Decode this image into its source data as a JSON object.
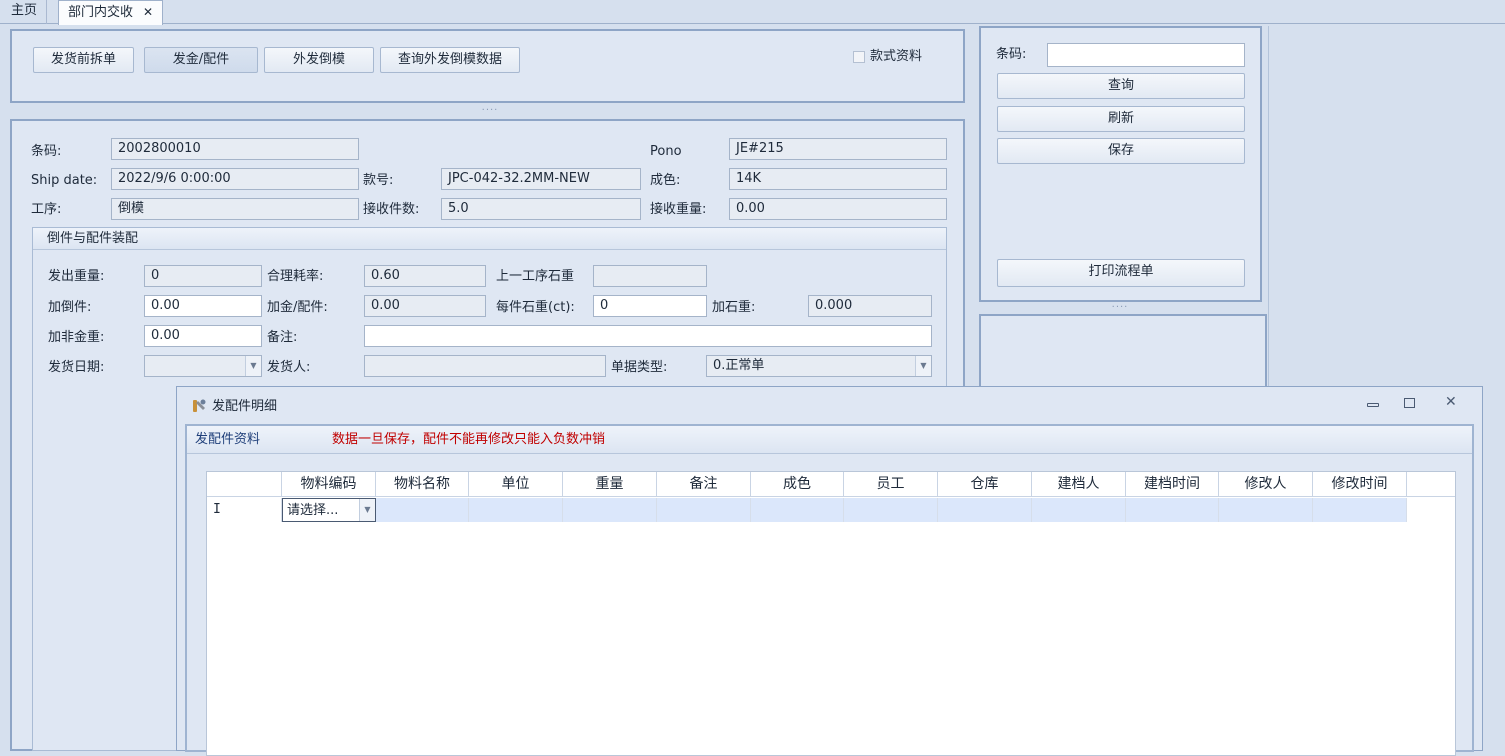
{
  "tabs": {
    "home": "主页",
    "active": "部门内交收",
    "close": "✕"
  },
  "toolbar": {
    "btn_split": "发货前拆单",
    "btn_gold": "发金/配件",
    "btn_outsource": "外发倒模",
    "btn_query_outsource": "查询外发倒模数据",
    "style_info_label": "款式资料"
  },
  "form": {
    "barcode_label": "条码:",
    "barcode_value": "2002800010",
    "pono_label": "Pono",
    "pono_value": "JE#215",
    "shipdate_label": "Ship date:",
    "shipdate_value": "2022/9/6 0:00:00",
    "style_label": "款号:",
    "style_value": "JPC-042-32.2MM-NEW",
    "purity_label": "成色:",
    "purity_value": "14K",
    "process_label": "工序:",
    "process_value": "倒模",
    "recv_qty_label": "接收件数:",
    "recv_qty_value": "5.0",
    "recv_weight_label": "接收重量:",
    "recv_weight_value": "0.00"
  },
  "group": {
    "title": "倒件与配件装配",
    "out_weight_label": "发出重量:",
    "out_weight_value": "0",
    "loss_rate_label": "合理耗率:",
    "loss_rate_value": "0.60",
    "prev_stone_label": "上一工序石重",
    "prev_stone_value": "",
    "add_cast_label": "加倒件:",
    "add_cast_value": "0.00",
    "add_gold_label": "加金/配件:",
    "add_gold_value": "0.00",
    "stone_each_label": "每件石重(ct):",
    "stone_each_value": "0",
    "add_stone_label": "加石重:",
    "add_stone_value": "0.000",
    "add_nongold_label": "加非金重:",
    "add_nongold_value": "0.00",
    "remark_label": "备注:",
    "remark_value": "",
    "ship_date_label": "发货日期:",
    "ship_date_value": "",
    "shipper_label": "发货人:",
    "shipper_value": "",
    "doc_type_label": "单据类型:",
    "doc_type_value": "0.正常单"
  },
  "side": {
    "barcode_label": "条码:",
    "barcode_value": "",
    "query": "查询",
    "refresh": "刷新",
    "save": "保存",
    "print": "打印流程单"
  },
  "dialog": {
    "title": "发配件明细",
    "section_label": "发配件资料",
    "warning": "数据一旦保存，配件不能再修改只能入负数冲销",
    "warning_color": "#c00000",
    "columns": [
      "物料编码",
      "物料名称",
      "单位",
      "重量",
      "备注",
      "成色",
      "员工",
      "仓库",
      "建档人",
      "建档时间",
      "修改人",
      "修改时间"
    ],
    "row_indicator": "I",
    "row_placeholder": "请选择..."
  }
}
